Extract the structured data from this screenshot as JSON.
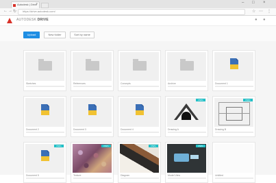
{
  "browser": {
    "tab_title": "Autodesk | Drive",
    "url": "https://drive.autodesk.com/"
  },
  "app": {
    "brand": "AUTODESK",
    "product": "DRIVE"
  },
  "toolbar": {
    "primary_label": "Upload",
    "secondary_1": "New folder",
    "secondary_2": "Sort by name"
  },
  "items": [
    {
      "type": "folder",
      "label": "Sketches"
    },
    {
      "type": "folder",
      "label": "References"
    },
    {
      "type": "folder",
      "label": "Concepts"
    },
    {
      "type": "folder",
      "label": "Archive"
    },
    {
      "type": "doc",
      "label": "Document 1"
    },
    {
      "type": "doc",
      "label": "Document 2"
    },
    {
      "type": "doc",
      "label": "Document 3"
    },
    {
      "type": "doc",
      "label": "Document 4"
    },
    {
      "type": "drawing",
      "label": "Drawing A",
      "badge": "DWG"
    },
    {
      "type": "tech",
      "label": "Drawing B",
      "badge": "DWG"
    },
    {
      "type": "doc",
      "label": "Document 5",
      "badge": "DWG"
    },
    {
      "type": "texture",
      "label": "Texture",
      "badge": "DWG"
    },
    {
      "type": "diag",
      "label": "Diagram",
      "badge": "DWG"
    },
    {
      "type": "dark",
      "label": "Model View",
      "badge": "DWG"
    },
    {
      "type": "blank",
      "label": "Untitled"
    }
  ]
}
